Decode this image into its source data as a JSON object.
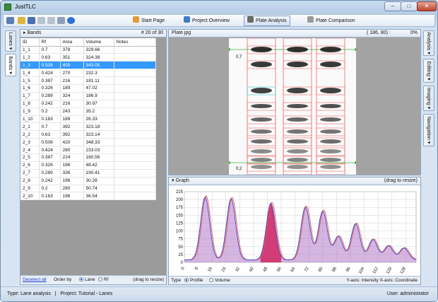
{
  "window": {
    "title": "JustTLC",
    "min": "–",
    "max": "□",
    "close": "✕"
  },
  "toolbar": {
    "tabs": [
      {
        "label": "Start Page",
        "icon": "start-page-icon"
      },
      {
        "label": "Project Overview",
        "icon": "project-overview-icon"
      },
      {
        "label": "Plate Analysis",
        "icon": "plate-analysis-icon",
        "active": true
      },
      {
        "label": "Plate Comparison",
        "icon": "plate-comparison-icon"
      }
    ]
  },
  "left_tabs": [
    "Lanes ▾",
    "Bands ▾"
  ],
  "right_tabs": [
    "Analysis ▾",
    "Editing ▾",
    "Imaging ▾",
    "Navigation ▾"
  ],
  "bands": {
    "title": "Bands",
    "count": "# 20 of 30",
    "columns": [
      "ID",
      "Rf",
      "Area",
      "Volume",
      "Notes"
    ],
    "rows": [
      [
        "1_1",
        "0.7",
        "378",
        "329.66",
        ""
      ],
      [
        "1_2",
        "0.63",
        "351",
        "324.38",
        ""
      ],
      [
        "1_3",
        "0.508",
        "405",
        "343.05",
        ""
      ],
      [
        "1_4",
        "0.424",
        "270",
        "232.3",
        ""
      ],
      [
        "1_5",
        "0.387",
        "216",
        "181.11",
        ""
      ],
      [
        "1_6",
        "0.326",
        "189",
        "47.02",
        ""
      ],
      [
        "1_7",
        "0.289",
        "324",
        "186.9",
        ""
      ],
      [
        "1_8",
        "0.242",
        "216",
        "30.97",
        ""
      ],
      [
        "1_9",
        "0.2",
        "243",
        "35.2",
        ""
      ],
      [
        "1_10",
        "0.163",
        "189",
        "26.33",
        ""
      ],
      [
        "2_1",
        "0.7",
        "392",
        "323.18",
        ""
      ],
      [
        "2_2",
        "0.63",
        "392",
        "323.14",
        ""
      ],
      [
        "2_3",
        "0.508",
        "420",
        "348.33",
        ""
      ],
      [
        "2_4",
        "0.424",
        "280",
        "233.03",
        ""
      ],
      [
        "2_5",
        "0.387",
        "224",
        "180.56",
        ""
      ],
      [
        "2_6",
        "0.326",
        "196",
        "48.42",
        ""
      ],
      [
        "2_7",
        "0.289",
        "336",
        "190.41",
        ""
      ],
      [
        "2_8",
        "0.242",
        "196",
        "30.28",
        ""
      ],
      [
        "2_9",
        "0.2",
        "280",
        "50.74",
        ""
      ],
      [
        "2_10",
        "0.163",
        "196",
        "36.54",
        ""
      ]
    ],
    "selected_row": 2,
    "footer": {
      "deselect": "Deselect all",
      "order_by": "Order by",
      "opt_lane": "Lane",
      "opt_rf": "Rf",
      "drag_hint": "(drag to resize)"
    }
  },
  "plate": {
    "file": "Plate.jpg",
    "coords": "( 186,  80) :",
    "zoom": "0%",
    "label_top": "0,7",
    "label_bottom": "0,2"
  },
  "graph": {
    "title": "Graph",
    "drag_hint": "(drag to resize)",
    "type_label": "Type",
    "opt_profile": "Profile",
    "opt_volume": "Volume",
    "axes_label": "Y-axis: Intensity   X-axis: Coordinate"
  },
  "chart_data": {
    "type": "area",
    "x_ticks": [
      0,
      8,
      16,
      24,
      32,
      40,
      48,
      56,
      64,
      72,
      80,
      88,
      96,
      104,
      112,
      120,
      128
    ],
    "y_ticks": [
      0,
      25,
      50,
      75,
      100,
      125,
      150,
      175,
      200,
      225
    ],
    "ylim": [
      0,
      225
    ],
    "xlim": [
      0,
      134
    ],
    "peaks": [
      {
        "x": 12,
        "y": 200
      },
      {
        "x": 27,
        "y": 195
      },
      {
        "x": 50,
        "y": 180
      },
      {
        "x": 70,
        "y": 168
      },
      {
        "x": 80,
        "y": 155
      },
      {
        "x": 89,
        "y": 75
      },
      {
        "x": 99,
        "y": 115
      },
      {
        "x": 109,
        "y": 65
      },
      {
        "x": 118,
        "y": 45
      },
      {
        "x": 127,
        "y": 38
      }
    ]
  },
  "status": {
    "type": "Type:  Lane analysis",
    "project": "Project:  Tutorial - Lanes",
    "user": "User:  administrator"
  }
}
